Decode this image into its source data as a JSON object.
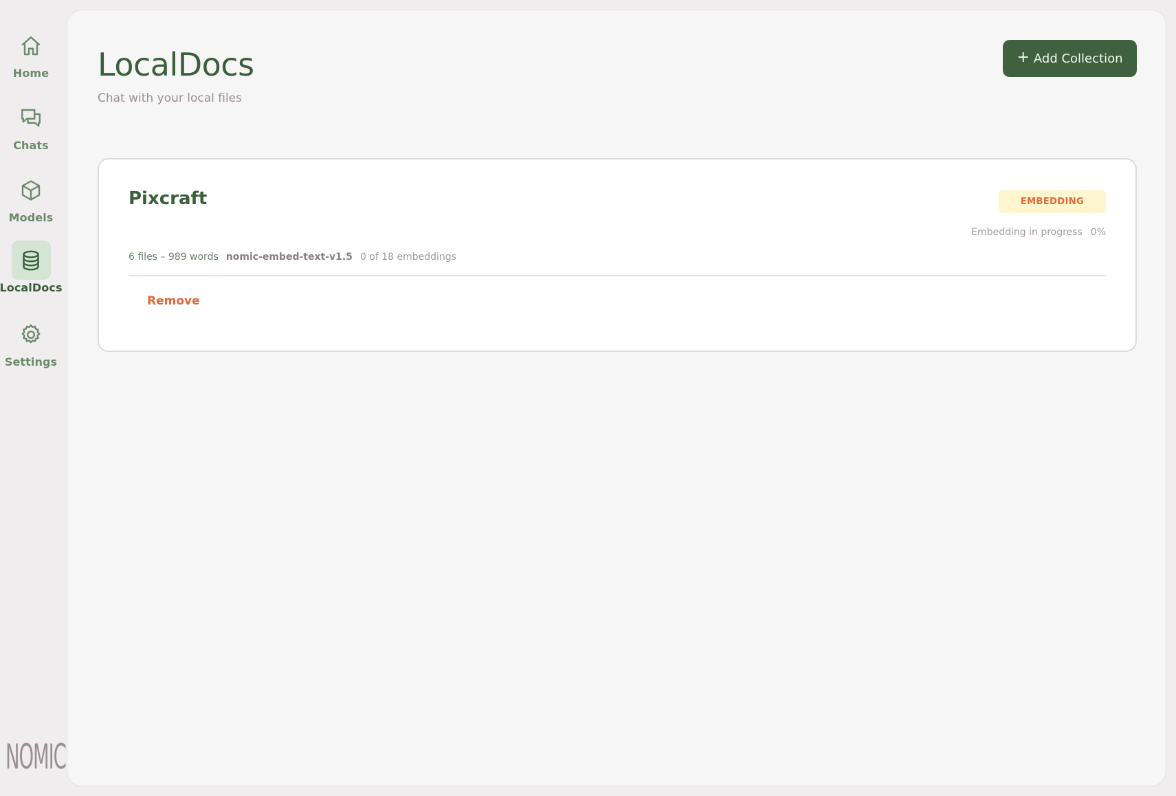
{
  "sidebar": {
    "items": [
      {
        "label": "Home",
        "icon": "home-icon",
        "active": false
      },
      {
        "label": "Chats",
        "icon": "chats-icon",
        "active": false
      },
      {
        "label": "Models",
        "icon": "cube-icon",
        "active": false
      },
      {
        "label": "LocalDocs",
        "icon": "database-icon",
        "active": true
      },
      {
        "label": "Settings",
        "icon": "gear-icon",
        "active": false
      }
    ],
    "logo_text": "NOMIC"
  },
  "header": {
    "title": "LocalDocs",
    "subtitle": "Chat with your local files",
    "add_button_label": "Add Collection",
    "add_button_icon": "plus-icon"
  },
  "collection": {
    "name": "Pixcraft",
    "status": "EMBEDDING",
    "progress_text": "Embedding in progress",
    "progress_percent": "0%",
    "files_words": "6 files – 989 words",
    "model": "nomic-embed-text-v1.5",
    "embeddings": "0 of 18 embeddings",
    "remove_label": "Remove"
  },
  "colors": {
    "accent_green": "#3f613f",
    "sidebar_active_bg": "#d4e5d4",
    "status_text": "#e0683a",
    "status_bg": "#fdf6cf",
    "remove_text": "#e0683a"
  }
}
